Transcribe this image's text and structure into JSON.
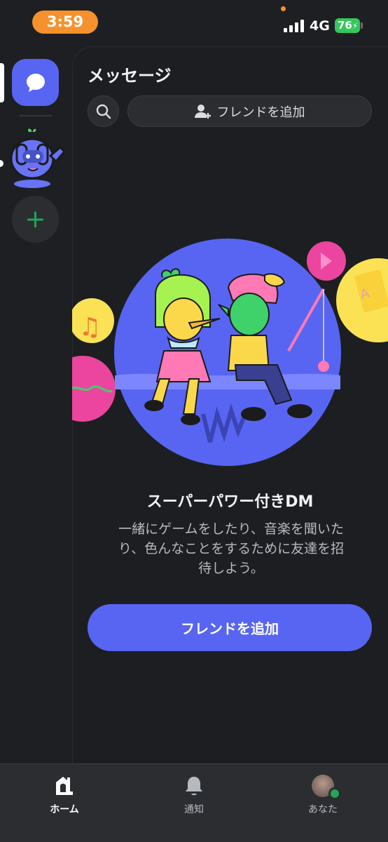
{
  "status_bar": {
    "time": "3:59",
    "network": "4G",
    "battery": "76"
  },
  "messages": {
    "title": "メッセージ",
    "add_friend_label": "フレンドを追加"
  },
  "empty_state": {
    "heading": "スーパーパワー付きDM",
    "description": "一緒にゲームをしたり、音楽を聞いたり、色んなことをするために友達を招待しよう。",
    "cta_label": "フレンドを追加"
  },
  "bottom_nav": [
    {
      "label": "ホーム",
      "icon": "home-icon",
      "active": true
    },
    {
      "label": "通知",
      "icon": "bell-icon",
      "active": false
    },
    {
      "label": "あなた",
      "icon": "avatar",
      "active": false
    }
  ],
  "colors": {
    "accent": "#5865f2",
    "background": "#1e1f22",
    "online": "#23a55a",
    "time_pill": "#f5922d"
  }
}
